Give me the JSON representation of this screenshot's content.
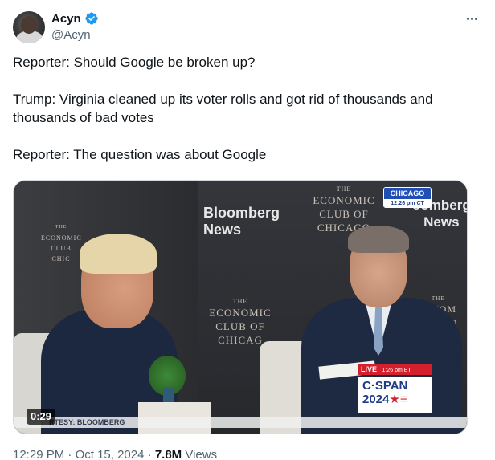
{
  "author": {
    "display_name": "Acyn",
    "handle": "@Acyn",
    "verified": true
  },
  "tweet": {
    "paragraphs": [
      "Reporter: Should Google be broken up?",
      "Trump: Virginia cleaned up its voter rolls and got rid of thousands and thousands of bad votes",
      "Reporter: The question was about Google"
    ]
  },
  "media": {
    "duration": "0:29",
    "wall_text_left": [
      "THE",
      "ECONOMIC",
      "CLUB",
      "CHIC"
    ],
    "wall_text_center_top": [
      "THE",
      "ECONOMIC",
      "CLUB OF",
      "CHICAGO"
    ],
    "wall_text_center_bottom": [
      "THE",
      "ECONOMIC",
      "CLUB OF",
      "CHICAG"
    ],
    "wall_text_right": [
      "THE",
      "NOM",
      "UB O",
      "AG"
    ],
    "bloomberg_left": [
      "Bloomberg",
      "News"
    ],
    "bloomberg_right": [
      "oomberg",
      "News"
    ],
    "badge_location": "CHICAGO",
    "badge_time": "12:26 pm CT",
    "live_label": "LIVE",
    "live_time": "1:26 pm ET",
    "cspan_line1": "C·SPAN",
    "cspan_line2": "2024",
    "courtesy": "RTESY: BLOOMBERG"
  },
  "footer": {
    "time": "12:29 PM",
    "separator": "·",
    "date": "Oct 15, 2024",
    "views_count": "7.8M",
    "views_label": "Views"
  },
  "icons": {
    "verified": "verified-badge-icon",
    "more": "more-options-icon"
  },
  "colors": {
    "verified_blue": "#1d9bf0",
    "secondary_text": "#536471",
    "cspan_red": "#d41f2d",
    "cspan_blue": "#1f3c88"
  }
}
